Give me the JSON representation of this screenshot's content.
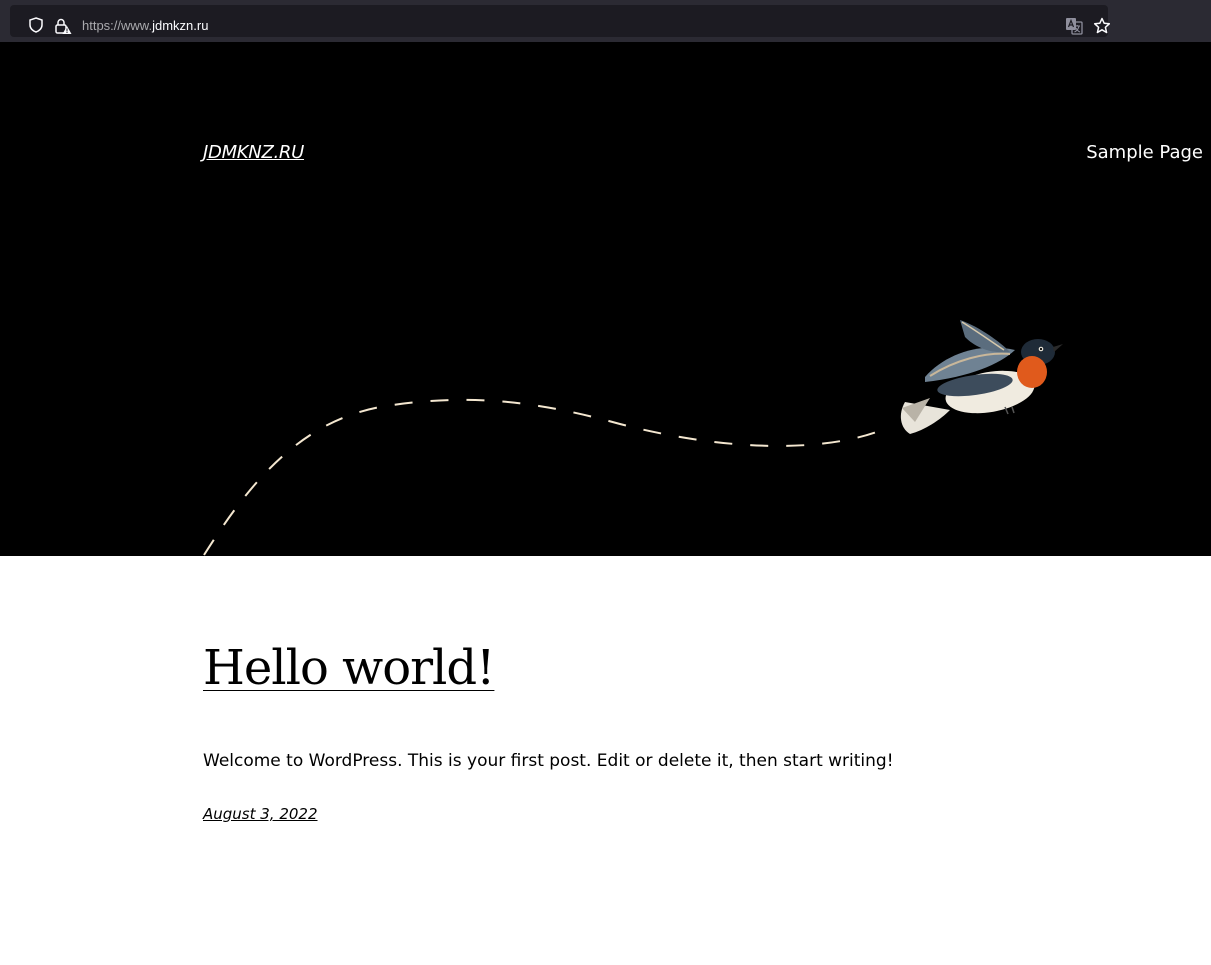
{
  "browser": {
    "url_protocol": "https://www.",
    "url_domain": "jdmkzn.ru"
  },
  "header": {
    "site_title": "JDMKNZ.RU",
    "nav_items": [
      "Sample Page"
    ]
  },
  "post": {
    "title": "Hello world!",
    "excerpt": "Welcome to WordPress. This is your first post. Edit or delete it, then start writing!",
    "date": "August 3, 2022"
  },
  "colors": {
    "hero_background": "#000000",
    "flight_path": "#f4e7d0",
    "page_background": "#ffffff"
  }
}
